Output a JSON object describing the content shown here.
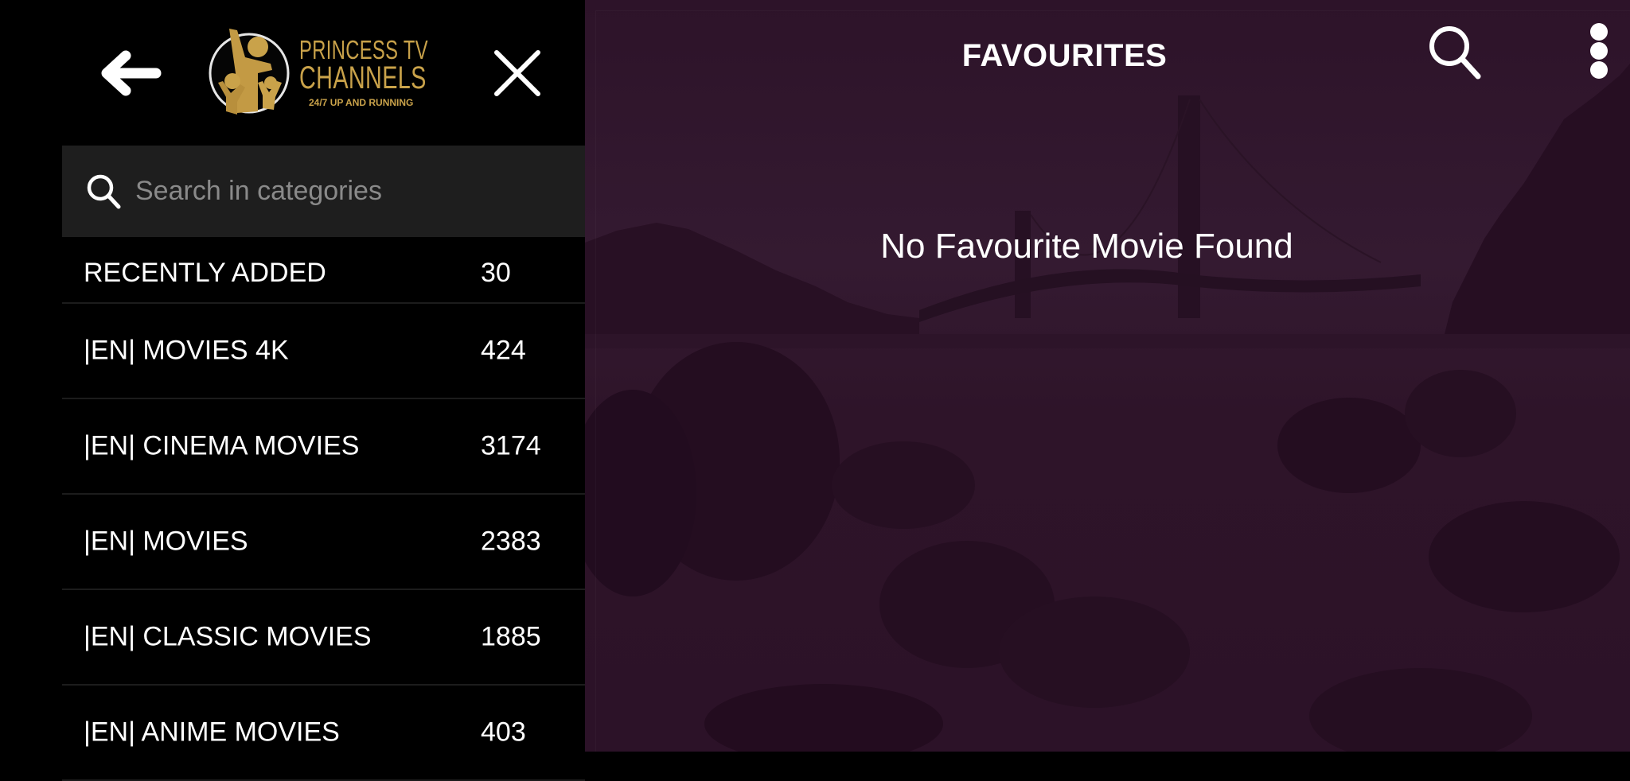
{
  "app": {
    "logo": {
      "line1": "PRINCESS TV",
      "line2": "CHANNELS",
      "tagline": "24/7 UP AND RUNNING"
    },
    "colors": {
      "gold": "#c9a24a",
      "main_bg": "#2a1127",
      "sidebar_bg": "#000000",
      "search_bg": "#1e1e1e"
    }
  },
  "sidebar": {
    "back_icon": "arrow-left-icon",
    "close_icon": "close-icon",
    "search": {
      "placeholder": "Search in categories",
      "value": "",
      "icon": "search-icon"
    },
    "categories": [
      {
        "name": "RECENTLY ADDED",
        "count": "30"
      },
      {
        "name": "|EN| MOVIES 4K",
        "count": "424"
      },
      {
        "name": "|EN| CINEMA MOVIES",
        "count": "3174"
      },
      {
        "name": "|EN| MOVIES",
        "count": "2383"
      },
      {
        "name": "|EN| CLASSIC MOVIES",
        "count": "1885"
      },
      {
        "name": "|EN| ANIME MOVIES",
        "count": "403"
      }
    ]
  },
  "main": {
    "title": "FAVOURITES",
    "search_icon": "search-icon",
    "more_icon": "more-vertical-icon",
    "empty_message": "No Favourite Movie Found"
  }
}
